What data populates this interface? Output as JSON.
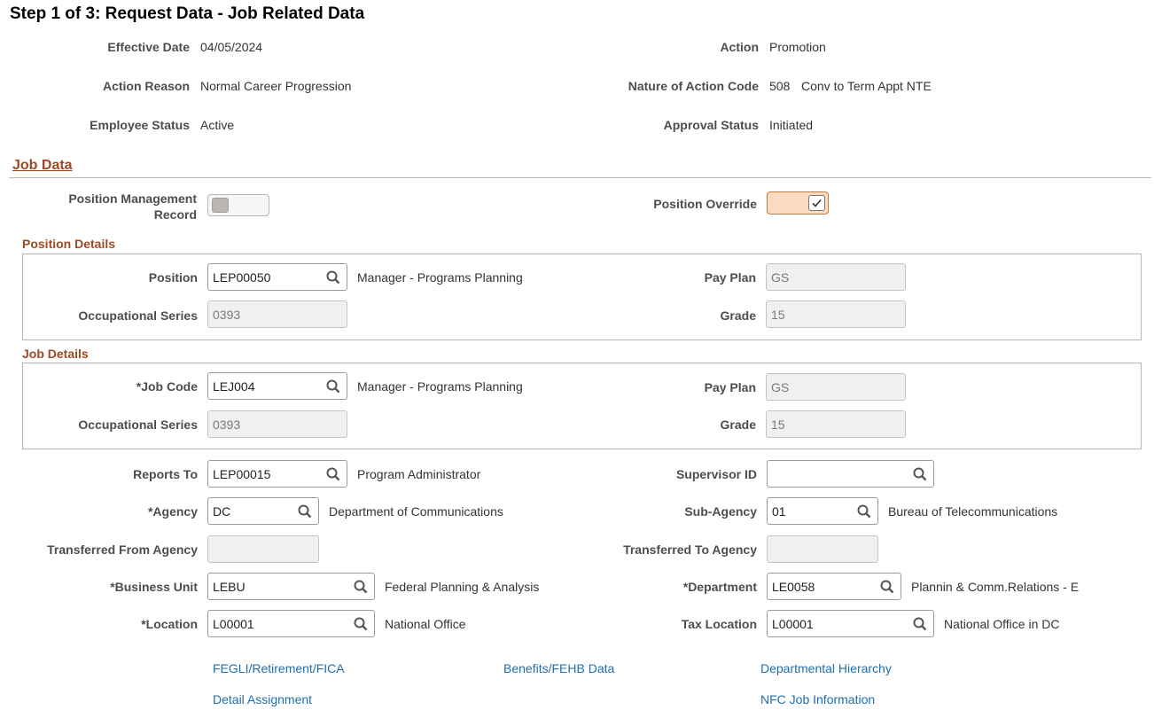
{
  "page": {
    "title": "Step 1 of 3: Request Data - Job Related Data"
  },
  "summary": {
    "effective_date": {
      "label": "Effective Date",
      "value": "04/05/2024"
    },
    "action": {
      "label": "Action",
      "value": "Promotion"
    },
    "action_reason": {
      "label": "Action Reason",
      "value": "Normal Career Progression"
    },
    "nature_of_action": {
      "label": "Nature of Action Code",
      "code": "508",
      "value": "Conv to Term Appt NTE"
    },
    "employee_status": {
      "label": "Employee Status",
      "value": "Active"
    },
    "approval_status": {
      "label": "Approval Status",
      "value": "Initiated"
    }
  },
  "job_data": {
    "section_title": "Job Data",
    "position_mgmt_label_1": "Position Management",
    "position_mgmt_label_2": "Record",
    "position_mgmt_on": false,
    "position_override_label": "Position Override",
    "position_override_checked": true
  },
  "position_details": {
    "title": "Position Details",
    "position_label": "Position",
    "position_value": "LEP00050",
    "position_desc": "Manager - Programs Planning",
    "pay_plan_label": "Pay Plan",
    "pay_plan_value": "GS",
    "occ_series_label": "Occupational Series",
    "occ_series_value": "0393",
    "grade_label": "Grade",
    "grade_value": "15"
  },
  "job_details": {
    "title": "Job Details",
    "job_code_label": "*Job Code",
    "job_code_value": "LEJ004",
    "job_code_desc": "Manager - Programs Planning",
    "pay_plan_label": "Pay Plan",
    "pay_plan_value": "GS",
    "occ_series_label": "Occupational Series",
    "occ_series_value": "0393",
    "grade_label": "Grade",
    "grade_value": "15"
  },
  "org": {
    "reports_to_label": "Reports To",
    "reports_to_value": "LEP00015",
    "reports_to_desc": "Program Administrator",
    "supervisor_label": "Supervisor ID",
    "supervisor_value": "",
    "agency_label": "*Agency",
    "agency_value": "DC",
    "agency_desc": "Department of Communications",
    "sub_agency_label": "Sub-Agency",
    "sub_agency_value": "01",
    "sub_agency_desc": "Bureau of Telecommunications",
    "transferred_from_label": "Transferred From Agency",
    "transferred_from_value": "",
    "transferred_to_label": "Transferred To Agency",
    "transferred_to_value": "",
    "business_unit_label": "*Business Unit",
    "business_unit_value": "LEBU",
    "business_unit_desc": "Federal Planning & Analysis",
    "department_label": "*Department",
    "department_value": "LE0058",
    "department_desc": "Plannin & Comm.Relations - E",
    "location_label": "*Location",
    "location_value": "L00001",
    "location_desc": "National Office",
    "tax_location_label": "Tax Location",
    "tax_location_value": "L00001",
    "tax_location_desc": "National Office in DC"
  },
  "links": {
    "fegli": "FEGLI/Retirement/FICA",
    "benefits": "Benefits/FEHB Data",
    "hierarchy": "Departmental Hierarchy",
    "detail": "Detail Assignment",
    "nfc": "NFC Job Information"
  },
  "icons": {
    "lookup": "magnifier-icon",
    "check": "checkmark-icon"
  },
  "colors": {
    "section": "#9c4a23",
    "link": "#1f6fae",
    "override_bg": "#fbdcc0"
  }
}
